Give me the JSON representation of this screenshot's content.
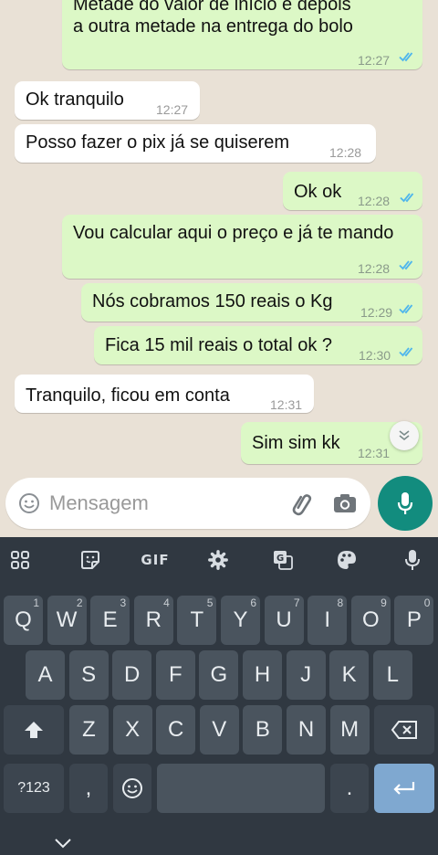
{
  "messages": [
    {
      "id": "m0",
      "dir": "out",
      "text_line1": "Metade do valor de início e depois",
      "text_line2": "a outra metade na entrega do bolo",
      "time": "12:27",
      "read": true
    },
    {
      "id": "m1",
      "dir": "in",
      "text": "Ok tranquilo",
      "time": "12:27"
    },
    {
      "id": "m2",
      "dir": "in",
      "text": "Posso fazer o pix já se quiserem",
      "time": "12:28"
    },
    {
      "id": "m3",
      "dir": "out",
      "text": "Ok ok",
      "time": "12:28",
      "read": true
    },
    {
      "id": "m4",
      "dir": "out",
      "text": "Vou calcular aqui o preço e já te mando",
      "time": "12:28",
      "read": true
    },
    {
      "id": "m5",
      "dir": "out",
      "text": "Nós cobramos 150 reais o Kg",
      "time": "12:29",
      "read": true
    },
    {
      "id": "m6",
      "dir": "out",
      "text": "Fica 15 mil reais o total ok ?",
      "time": "12:30",
      "read": true
    },
    {
      "id": "m7",
      "dir": "in",
      "text": "Tranquilo, ficou em conta",
      "time": "12:31"
    },
    {
      "id": "m8",
      "dir": "out",
      "text": "Sim sim kk",
      "time": "12:31",
      "read": false
    }
  ],
  "composer": {
    "placeholder": "Mensagem",
    "icons": [
      "emoji-icon",
      "attach-icon",
      "camera-icon",
      "mic-icon"
    ]
  },
  "keyboard": {
    "toolbar": [
      "apps-icon",
      "sticker-icon",
      "GIF",
      "settings-icon",
      "translate-icon",
      "palette-icon",
      "mic-icon"
    ],
    "gif_label": "GIF",
    "row1": [
      {
        "k": "Q",
        "h": "1"
      },
      {
        "k": "W",
        "h": "2"
      },
      {
        "k": "E",
        "h": "3"
      },
      {
        "k": "R",
        "h": "4"
      },
      {
        "k": "T",
        "h": "5"
      },
      {
        "k": "Y",
        "h": "6"
      },
      {
        "k": "U",
        "h": "7"
      },
      {
        "k": "I",
        "h": "8"
      },
      {
        "k": "O",
        "h": "9"
      },
      {
        "k": "P",
        "h": "0"
      }
    ],
    "row2": [
      "A",
      "S",
      "D",
      "F",
      "G",
      "H",
      "J",
      "K",
      "L"
    ],
    "row3": [
      "Z",
      "X",
      "C",
      "V",
      "B",
      "N",
      "M"
    ],
    "symbols_label": "?123",
    "comma_label": ",",
    "period_label": "."
  },
  "colors": {
    "outgoing_bubble": "#dcf8c6",
    "incoming_bubble": "#ffffff",
    "read_tick": "#4fb6ec",
    "fab": "#128c7e",
    "keyboard_bg": "#303841",
    "key_bg": "#4a545e",
    "enter_key": "#7fa8d0"
  }
}
